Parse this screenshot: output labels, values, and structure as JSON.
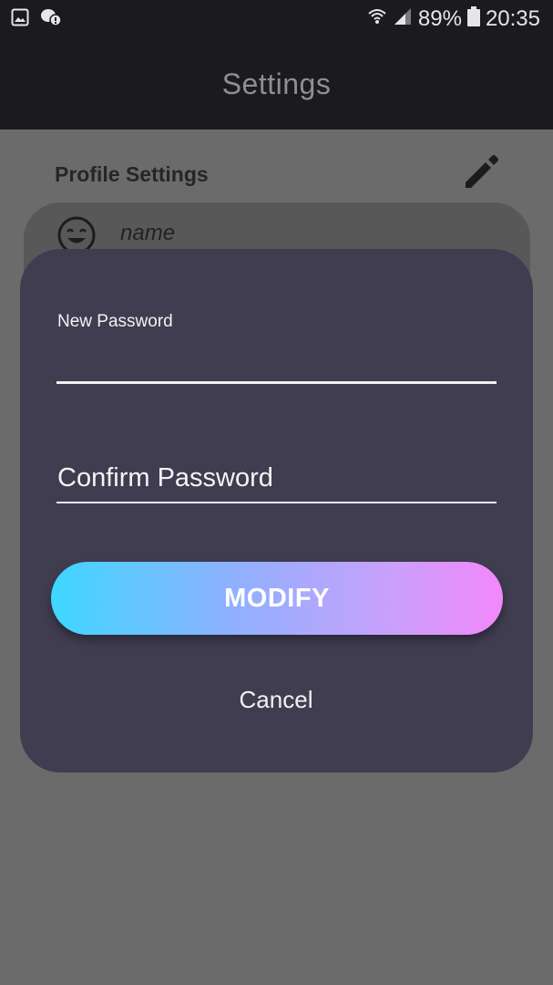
{
  "status_bar": {
    "notification_icons": [
      "gallery-icon",
      "chat-icon"
    ],
    "wifi_icon": "wifi-icon",
    "signal_icon": "signal-icon",
    "battery_percent": "89%",
    "battery_icon": "battery-icon",
    "time": "20:35"
  },
  "app_bar": {
    "title": "Settings"
  },
  "profile": {
    "section_title": "Profile Settings",
    "edit_icon": "pencil-icon",
    "avatar_icon": "smiley-icon",
    "name_value": "name"
  },
  "dialog": {
    "new_password_label": "New Password",
    "new_password_value": "",
    "confirm_password_placeholder": "Confirm Password",
    "modify_label": "MODIFY",
    "cancel_label": "Cancel"
  },
  "colors": {
    "app_bar": "#1b1a1f",
    "dialog_bg": "#403d51",
    "overlay": "#6b6b6b",
    "button_gradient_start": "#3ed7ff",
    "button_gradient_end": "#f288fb"
  }
}
